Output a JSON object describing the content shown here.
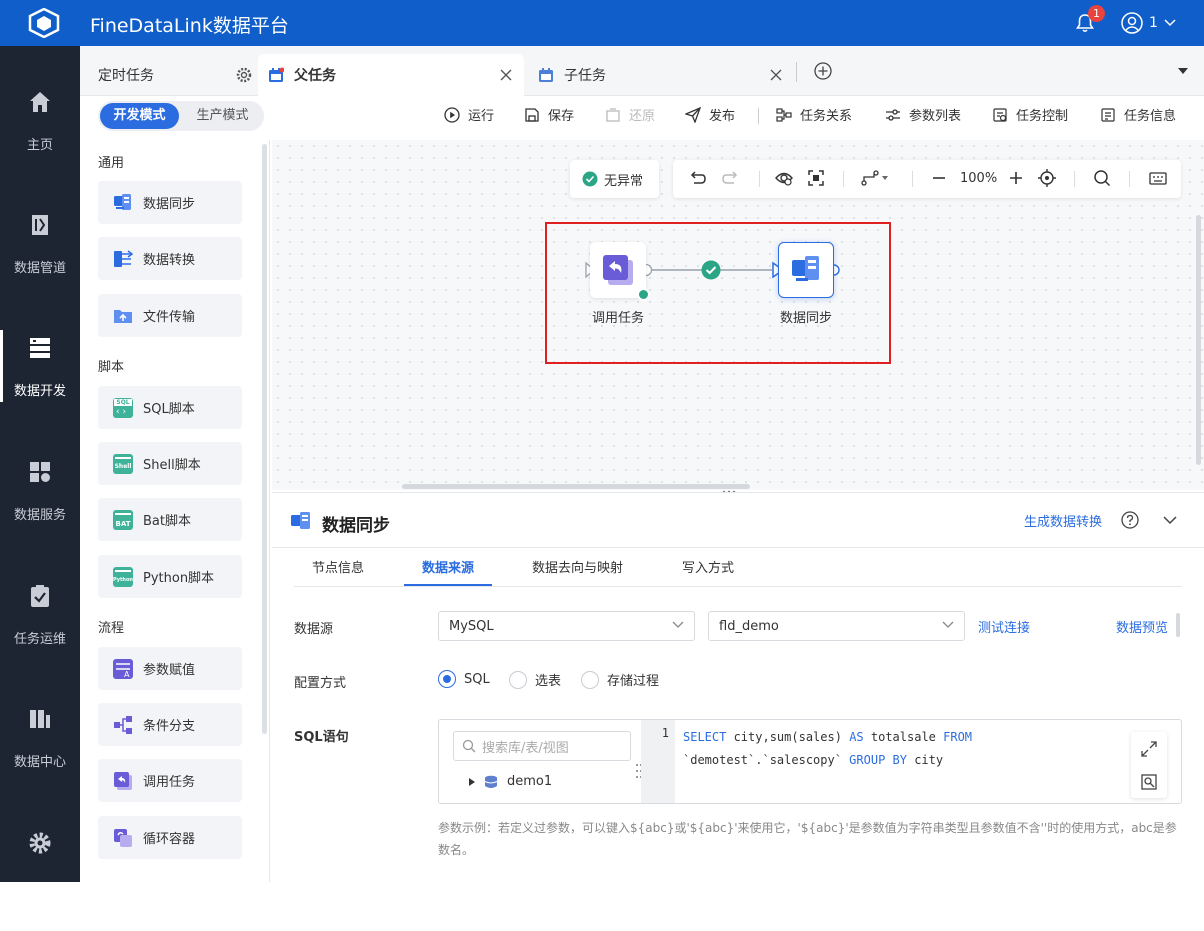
{
  "app": {
    "title": "FineDataLink数据平台",
    "notification_count": "1",
    "user_name": "1"
  },
  "leftnav": [
    {
      "label": "主页",
      "icon": "home-icon"
    },
    {
      "label": "数据管道",
      "icon": "pipeline-icon"
    },
    {
      "label": "数据开发",
      "icon": "dev-icon",
      "active": true
    },
    {
      "label": "数据服务",
      "icon": "service-icon"
    },
    {
      "label": "任务运维",
      "icon": "ops-icon"
    },
    {
      "label": "数据中心",
      "icon": "datacenter-icon"
    },
    {
      "label": "",
      "icon": "gear-icon"
    }
  ],
  "tabs": [
    {
      "label": "定时任务"
    },
    {
      "label": "父任务",
      "active": true
    },
    {
      "label": "子任务"
    }
  ],
  "mode": {
    "dev": "开发模式",
    "prod": "生产模式"
  },
  "toolbar": {
    "run": "运行",
    "save": "保存",
    "restore": "还原",
    "publish": "发布",
    "task_relation": "任务关系",
    "param_list": "参数列表",
    "task_control": "任务控制",
    "task_info": "任务信息"
  },
  "palette": {
    "groups": [
      "通用",
      "脚本",
      "流程"
    ],
    "items": [
      {
        "label": "数据同步",
        "icon": "data-sync-icon"
      },
      {
        "label": "数据转换",
        "icon": "data-transform-icon"
      },
      {
        "label": "文件传输",
        "icon": "file-transfer-icon"
      },
      {
        "label": "SQL脚本",
        "icon": "sql-script-icon"
      },
      {
        "label": "Shell脚本",
        "icon": "shell-script-icon"
      },
      {
        "label": "Bat脚本",
        "icon": "bat-script-icon"
      },
      {
        "label": "Python脚本",
        "icon": "python-script-icon"
      },
      {
        "label": "参数赋值",
        "icon": "param-assign-icon"
      },
      {
        "label": "条件分支",
        "icon": "condition-branch-icon"
      },
      {
        "label": "调用任务",
        "icon": "invoke-task-icon"
      },
      {
        "label": "循环容器",
        "icon": "loop-container-icon"
      }
    ]
  },
  "canvas": {
    "status": "无异常",
    "zoom": "100%",
    "nodes": [
      {
        "label": "调用任务"
      },
      {
        "label": "数据同步"
      }
    ]
  },
  "panel": {
    "title": "数据同步",
    "generate_link": "生成数据转换",
    "subtabs": [
      "节点信息",
      "数据来源",
      "数据去向与映射",
      "写入方式"
    ],
    "active_subtab": "数据来源",
    "datasource_label": "数据源",
    "datasource_type": "MySQL",
    "datasource_conn": "fld_demo",
    "test_conn": "测试连接",
    "preview": "数据预览",
    "config_label": "配置方式",
    "config_options": [
      "SQL",
      "选表",
      "存储过程"
    ],
    "config_selected": "SQL",
    "sql_label": "SQL语句",
    "search_placeholder": "搜索库/表/视图",
    "tree_db": "demo1",
    "line_no": "1",
    "sql": {
      "l1_kw1": "SELECT",
      "l1_mid": " city,sum(sales) ",
      "l1_kw2": "AS",
      "l1_mid2": " totalsale ",
      "l1_kw3": "FROM",
      "l2_txt": "`demotest`.`salescopy` ",
      "l2_kw": "GROUP BY",
      "l2_end": " city"
    },
    "hint": "参数示例：若定义过参数，可以键入${abc}或'${abc}'来使用它，'${abc}'是参数值为字符串类型且参数值不含''时的使用方式，abc是参数名。"
  },
  "colors": {
    "primary": "#2b6de0",
    "topbar": "#0f5ec9",
    "nav": "#1d2533",
    "success": "#2aa586",
    "highlight": "#e02020"
  }
}
